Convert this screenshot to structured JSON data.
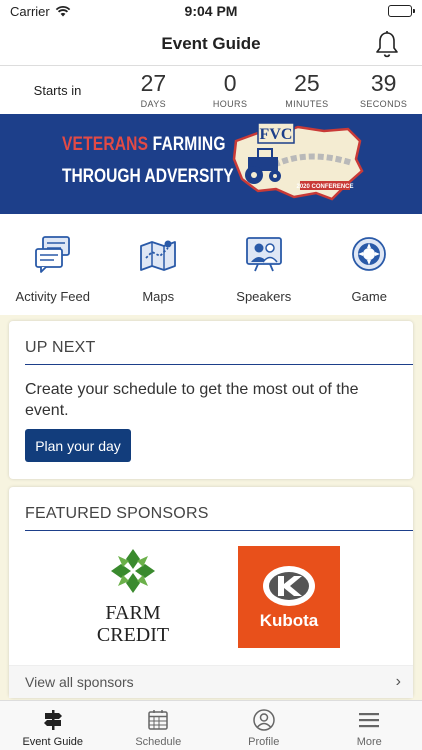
{
  "status": {
    "carrier": "Carrier",
    "time": "9:04 PM"
  },
  "nav": {
    "title": "Event Guide",
    "bell_icon": "bell-icon"
  },
  "countdown": {
    "label": "Starts in",
    "units": [
      {
        "value": "27",
        "unit": "DAYS"
      },
      {
        "value": "0",
        "unit": "HOURS"
      },
      {
        "value": "25",
        "unit": "MINUTES"
      },
      {
        "value": "39",
        "unit": "SECONDS"
      }
    ]
  },
  "banner": {
    "line1_red": "VETERANS",
    "line1_rest": " FARMING",
    "line2": "THROUGH ADVERSITY",
    "logo_text": "FVC",
    "logo_sub": "2020 CONFERENCE"
  },
  "shortcuts": [
    {
      "label": "Activity Feed",
      "icon": "activity-feed-icon"
    },
    {
      "label": "Maps",
      "icon": "map-icon"
    },
    {
      "label": "Speakers",
      "icon": "speakers-icon"
    },
    {
      "label": "Game",
      "icon": "game-icon"
    }
  ],
  "up_next": {
    "header": "UP NEXT",
    "body": "Create your schedule to get the most out of the event.",
    "button": "Plan your day"
  },
  "sponsors": {
    "header": "FEATURED SPONSORS",
    "logos": [
      {
        "name": "Farm Credit",
        "line1": "FARM",
        "line2": "CREDIT"
      },
      {
        "name": "Kubota",
        "text": "Kubota"
      }
    ],
    "view_all": "View all sponsors"
  },
  "tabs": [
    {
      "label": "Event Guide",
      "icon": "signpost-icon",
      "active": true
    },
    {
      "label": "Schedule",
      "icon": "calendar-icon",
      "active": false
    },
    {
      "label": "Profile",
      "icon": "profile-icon",
      "active": false
    },
    {
      "label": "More",
      "icon": "menu-icon",
      "active": false
    }
  ],
  "colors": {
    "brand_blue": "#1d3f8a",
    "button_blue": "#123d7c",
    "accent_red": "#e24a45",
    "kubota_orange": "#e8501b",
    "farm_credit_green": "#3a8a2e"
  }
}
